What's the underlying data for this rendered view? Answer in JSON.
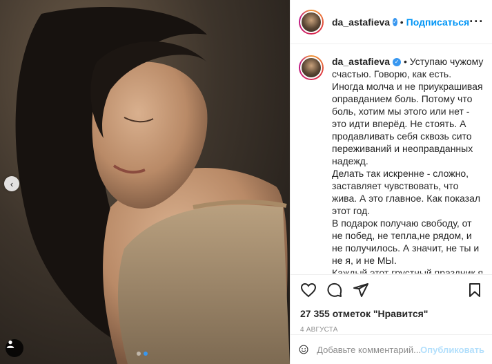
{
  "post": {
    "username": "da_astafieva",
    "separator": "•",
    "follow_label": "Подписаться",
    "more_label": "···",
    "caption": "Уступаю чужому счастью. Говорю, как есть. Иногда молча и не приукрашивая оправданием боль. Потому что боль, хотим мы этого или нет - это идти вперёд. Не стоять. А продавливать себя сквозь сито переживаний и неоправданных надежд.\nДелать так искренне - сложно, заставляет чувствовать, что жива. А это главное. Как показал этот год.\nВ подарок получаю свободу, от не побед, не тепла,не рядом, и не получилось. А значит, не ты и не я, и не МЫ.\nКаждый этот грустный праздник я надеюсь, что стала чуточку мудрее.\nЧуточку выше и крепче.\nЧуточку собой.",
    "likes": "27 355 отметок \"Нравится\"",
    "date": "4 АВГУСТА",
    "comment_placeholder": "Добавьте комментарий...",
    "publish_label": "Опубликовать",
    "carousel": {
      "total": 2,
      "current": 2
    }
  },
  "icons": {
    "prev": "chevron-left-icon",
    "tag": "user-tag-icon",
    "like": "heart-icon",
    "comment": "comment-icon",
    "share": "paper-plane-icon",
    "save": "bookmark-icon",
    "emoji": "smile-icon",
    "verified": "verified-badge-icon"
  },
  "colors": {
    "accent": "#0095f6",
    "publish_disabled": "#b2dffc",
    "muted": "#8e8e8e",
    "carousel_active": "#3897f0"
  }
}
